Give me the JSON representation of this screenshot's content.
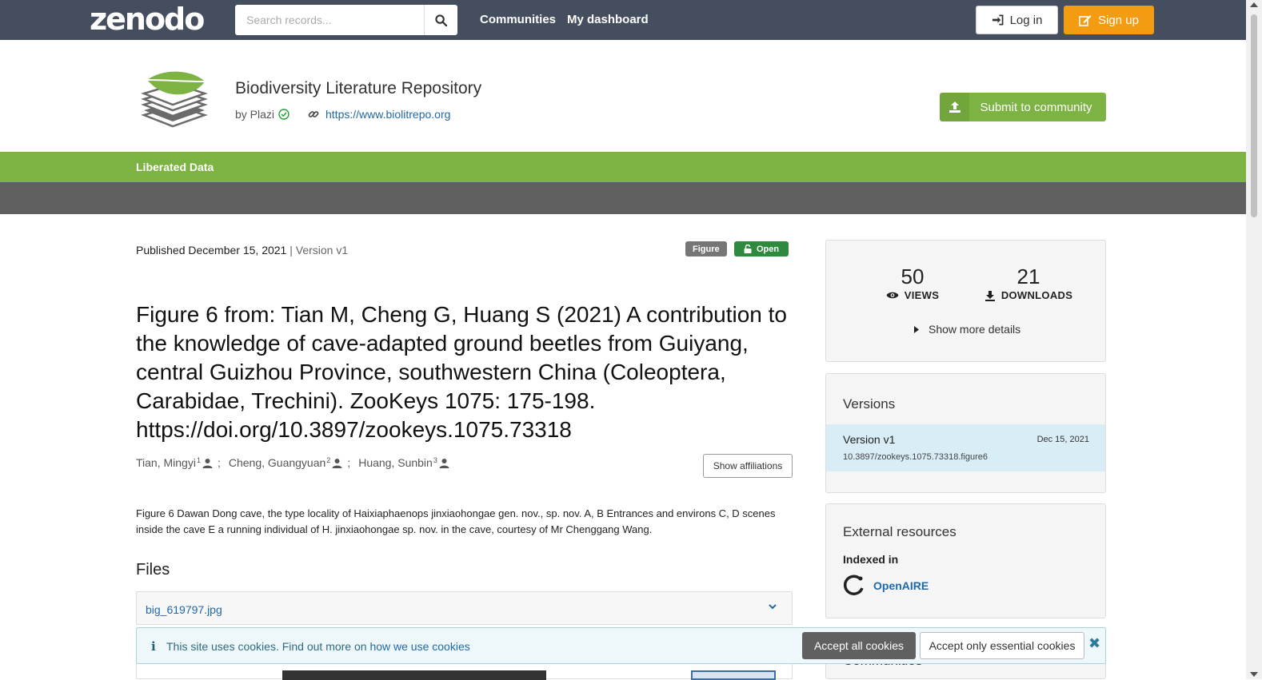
{
  "navbar": {
    "logo": "zenodo",
    "search_placeholder": "Search records...",
    "links": [
      "Communities",
      "My dashboard"
    ],
    "login": "Log in",
    "signup": "Sign up"
  },
  "community": {
    "title": "Biodiversity Literature Repository",
    "by": "by Plazi",
    "url": "https://www.biolitrepo.org",
    "submit": "Submit to community",
    "menu": "Liberated Data"
  },
  "record": {
    "published": "Published December 15, 2021",
    "separator": "|",
    "version": "Version v1",
    "badge_type": "Figure",
    "badge_access": "Open",
    "title": "Figure 6 from: Tian M, Cheng G, Huang S (2021) A contribution to the knowledge of cave-adapted ground beetles from Guiyang, central Guizhou Province, southwestern China (Coleoptera, Carabidae, Trechini). ZooKeys 1075: 175-198. https://doi.org/10.3897/zookeys.1075.73318",
    "creators": [
      {
        "name": "Tian, Mingyi",
        "aff": "1"
      },
      {
        "name": "Cheng, Guangyuan",
        "aff": "2"
      },
      {
        "name": "Huang, Sunbin",
        "aff": "3"
      }
    ],
    "creator_sep": ";",
    "show_affiliations": "Show affiliations",
    "description": "Figure 6 Dawan Dong cave, the type locality of Haixiaphaenops jinxiaohongae gen. nov., sp. nov. A, B Entrances and environs C, D scenes inside the cave E a running individual of H. jinxiaohongae sp. nov. in the cave, courtesy of Mr Chenggang Wang.",
    "files_heading": "Files",
    "file_name": "big_619797.jpg"
  },
  "stats": {
    "views": "50",
    "views_label": "VIEWS",
    "downloads": "21",
    "downloads_label": "DOWNLOADS",
    "more": "Show more details"
  },
  "versions": {
    "heading": "Versions",
    "label": "Version v1",
    "date": "Dec 15, 2021",
    "doi": "10.3897/zookeys.1075.73318.figure6"
  },
  "external": {
    "heading": "External resources",
    "indexed": "Indexed in",
    "openaire": "OpenAIRE"
  },
  "peek_heading": "Communities",
  "cookie": {
    "icon": "i",
    "text": "This site uses cookies. Find out more on ",
    "link": "how we use cookies",
    "accept_all": "Accept all cookies",
    "accept_essential": "Accept only essential cookies",
    "close": "✖"
  },
  "colors": {
    "navbar": "#444e5e",
    "brand_green": "#7cb342",
    "signup_orange": "#f39c12",
    "link_blue": "#2169a8"
  }
}
